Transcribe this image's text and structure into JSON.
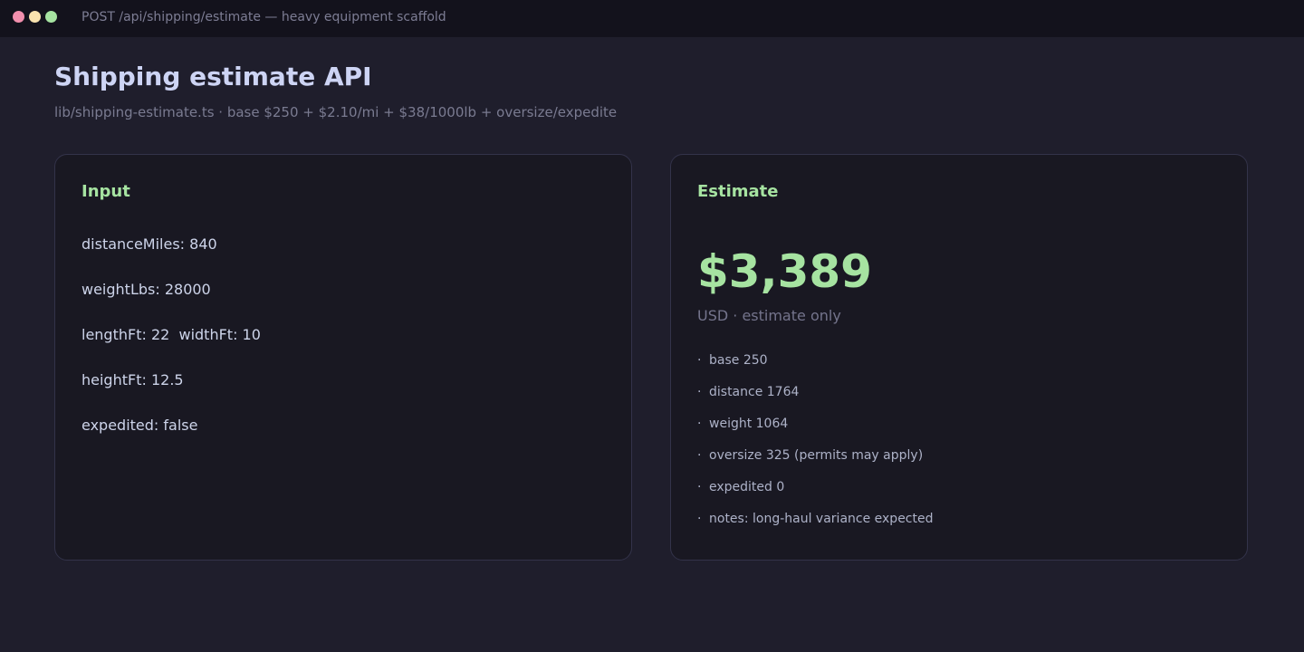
{
  "window": {
    "title": "POST /api/shipping/estimate — heavy equipment scaffold"
  },
  "header": {
    "title": "Shipping estimate API",
    "subtitle": "lib/shipping-estimate.ts · base $250 + $2.10/mi + $38/1000lb + oversize/expedite"
  },
  "input": {
    "heading": "Input",
    "fields": [
      "distanceMiles: 840",
      "weightLbs: 28000",
      "lengthFt: 22  widthFt: 10",
      "heightFt: 12.5",
      "expedited: false"
    ]
  },
  "estimate": {
    "heading": "Estimate",
    "total": "$3,389",
    "currency_note": "USD · estimate only",
    "bullet": "·",
    "breakdown": [
      "base 250",
      "distance 1764",
      "weight 1064",
      "oversize 325 (permits may apply)",
      "expedited 0",
      "notes: long-haul variance expected"
    ]
  },
  "colors": {
    "accent": "#a6e3a1",
    "background": "#1f1e2c",
    "card": "#191822"
  }
}
